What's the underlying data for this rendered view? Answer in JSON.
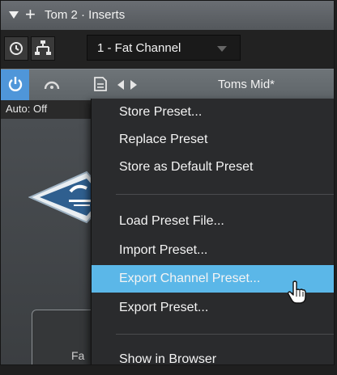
{
  "titlebar": {
    "title": "Tom 2 · Inserts"
  },
  "channel": {
    "selected": "1 - Fat Channel"
  },
  "preset_bar": {
    "preset_name": "Toms Mid*"
  },
  "automation": {
    "label": "Auto: Off"
  },
  "plugin": {
    "partial_text": "Fa"
  },
  "colors": {
    "accent": "#4f96d9",
    "highlight": "#5bb7e8",
    "menu_bg": "#2a2b2d"
  },
  "menu": {
    "items": [
      {
        "label": "Store Preset..."
      },
      {
        "label": "Replace Preset"
      },
      {
        "label": "Store as Default Preset"
      },
      {
        "label": "Load Preset File..."
      },
      {
        "label": "Import Preset..."
      },
      {
        "label": "Export Channel Preset...",
        "highlighted": true
      },
      {
        "label": "Export Preset..."
      },
      {
        "label": "Show in Browser"
      }
    ]
  }
}
